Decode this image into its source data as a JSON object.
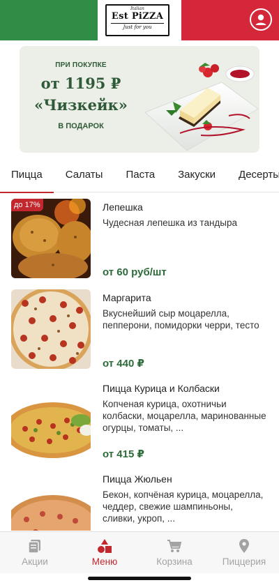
{
  "header": {
    "logo_top": "Italian",
    "logo_main": "Est PiZZA",
    "logo_sub": "Just for you",
    "profile_icon": "profile-icon"
  },
  "banner": {
    "line1": "ПРИ ПОКУПКЕ",
    "line2": "от 1195 ₽",
    "line3": "«Чизкейк»",
    "line4": "В ПОДАРОК"
  },
  "tabs": [
    {
      "label": "Пицца",
      "active": true
    },
    {
      "label": "Салаты"
    },
    {
      "label": "Паста"
    },
    {
      "label": "Закуски"
    },
    {
      "label": "Десерты"
    }
  ],
  "products": [
    {
      "title": "Лепешка",
      "desc": "Чудесная лепешка из тандыра",
      "price": "от 60 руб/шт",
      "badge": "до 17%"
    },
    {
      "title": "Маргарита",
      "desc": "Вкуснейший сыр моцарелла, пепперони, помидорки черри, тесто",
      "price": "от 440 ₽"
    },
    {
      "title": "Пицца Курица и Колбаски",
      "desc": "Копченая курица, охотничьи колбаски, моцарелла, маринованные огурцы, томаты, ...",
      "price": "от 415 ₽"
    },
    {
      "title": "Пицца Жюльен",
      "desc": "Бекон, копчёная курица, моцарелла, чеддер, свежие шампиньоны, сливки, укроп, ..."
    }
  ],
  "nav": [
    {
      "label": "Акции",
      "icon": "promotions-icon"
    },
    {
      "label": "Меню",
      "icon": "menu-icon",
      "active": true
    },
    {
      "label": "Корзина",
      "icon": "cart-icon"
    },
    {
      "label": "Пиццерия",
      "icon": "location-pin-icon"
    }
  ],
  "colors": {
    "brand_red": "#c1272d",
    "flag_green": "#2f8d45",
    "price_green": "#2e6b3a"
  }
}
